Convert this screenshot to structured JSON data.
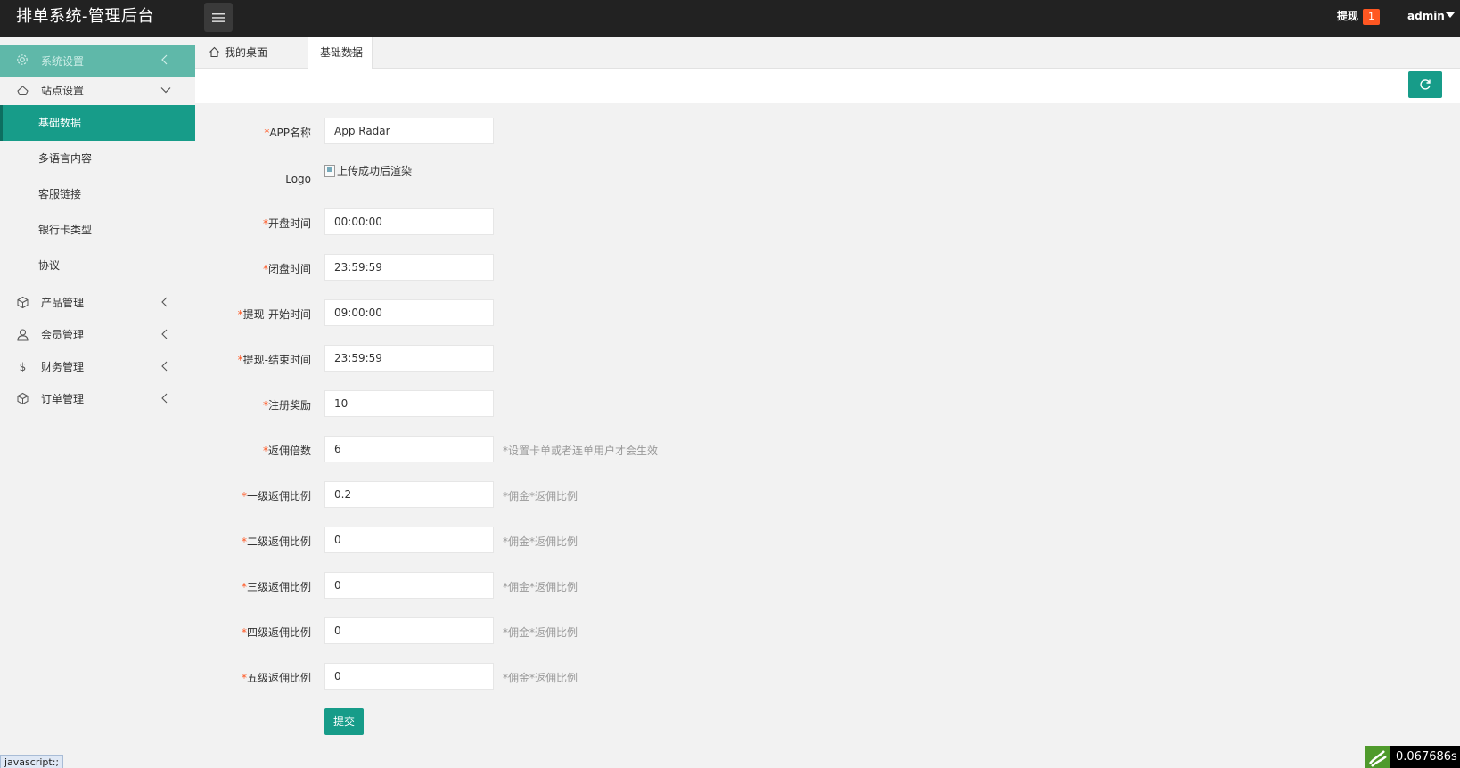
{
  "header": {
    "title": "排单系统-管理后台",
    "withdraw_label": "提现",
    "withdraw_badge": "1",
    "user": "admin"
  },
  "sidebar": {
    "top": {
      "label": "系统设置",
      "icon": "gear-icon"
    },
    "groups": [
      {
        "label": "站点设置",
        "icon": "site-icon",
        "expanded": true
      },
      {
        "label": "产品管理",
        "icon": "box-icon"
      },
      {
        "label": "会员管理",
        "icon": "user-icon"
      },
      {
        "label": "财务管理",
        "icon": "dollar-icon"
      },
      {
        "label": "订单管理",
        "icon": "box-icon"
      }
    ],
    "sub_items": [
      {
        "label": "基础数据",
        "active": true
      },
      {
        "label": "多语言内容"
      },
      {
        "label": "客服链接"
      },
      {
        "label": "银行卡类型"
      },
      {
        "label": "协议"
      }
    ]
  },
  "tabs": {
    "home": "我的桌面",
    "active": "基础数据"
  },
  "form": {
    "app_name": {
      "label": "APP名称",
      "value": "App Radar"
    },
    "logo": {
      "label": "Logo",
      "alt": "上传成功后渲染"
    },
    "open_time": {
      "label": "开盘时间",
      "value": "00:00:00"
    },
    "close_time": {
      "label": "闭盘时间",
      "value": "23:59:59"
    },
    "withdraw_start": {
      "label": "提现-开始时间",
      "value": "09:00:00"
    },
    "withdraw_end": {
      "label": "提现-结束时间",
      "value": "23:59:59"
    },
    "register_reward": {
      "label": "注册奖励",
      "value": "10"
    },
    "commission_multiple": {
      "label": "返佣倍数",
      "value": "6",
      "hint": "*设置卡单或者连单用户才会生效"
    },
    "level1": {
      "label": "一级返佣比例",
      "value": "0.2",
      "hint": "*佣金*返佣比例"
    },
    "level2": {
      "label": "二级返佣比例",
      "value": "0",
      "hint": "*佣金*返佣比例"
    },
    "level3": {
      "label": "三级返佣比例",
      "value": "0",
      "hint": "*佣金*返佣比例"
    },
    "level4": {
      "label": "四级返佣比例",
      "value": "0",
      "hint": "*佣金*返佣比例"
    },
    "level5": {
      "label": "五级返佣比例",
      "value": "0",
      "hint": "*佣金*返佣比例"
    },
    "required_mark": "*",
    "submit_label": "提交"
  },
  "status": {
    "link_preview": "javascript:;",
    "timer": "0.067686s"
  },
  "colors": {
    "header_bg": "#222222",
    "accent": "#179c89",
    "sidebar_top": "#5fb8a9",
    "badge": "#ff5722",
    "required": "#ff5722",
    "hint": "#999999"
  }
}
